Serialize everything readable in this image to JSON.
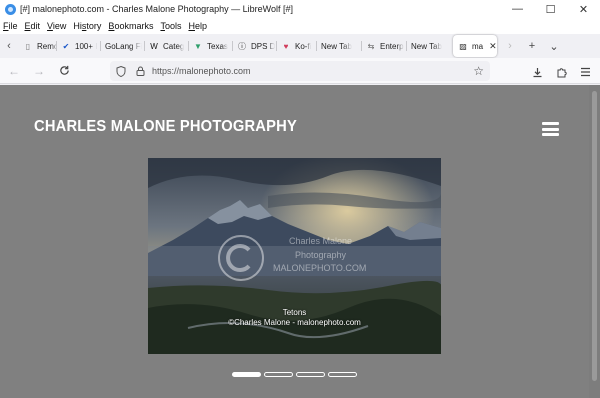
{
  "window": {
    "title": "[#] malonephoto.com - Charles Malone Photography — LibreWolf [#]",
    "controls": [
      "—",
      "☐",
      "✕"
    ]
  },
  "menu": [
    {
      "label": "File",
      "key": "F",
      "rest": "ile"
    },
    {
      "label": "Edit",
      "key": "E",
      "rest": "dit"
    },
    {
      "label": "View",
      "key": "V",
      "rest": "iew"
    },
    {
      "label": "History",
      "key": "s",
      "pre": "Hi",
      "rest": "tory"
    },
    {
      "label": "Bookmarks",
      "key": "B",
      "rest": "ookmarks"
    },
    {
      "label": "Tools",
      "key": "T",
      "rest": "ools"
    },
    {
      "label": "Help",
      "key": "H",
      "rest": "elp"
    }
  ],
  "tabs": [
    {
      "label": "Remo",
      "icon": "bookmark-icon",
      "glyph": "▯",
      "color": "#777"
    },
    {
      "label": "100+ I",
      "icon": "check-icon",
      "glyph": "✔",
      "color": "#1a57c9"
    },
    {
      "label": "GoLang Fi",
      "icon": "",
      "glyph": "",
      "color": "#555"
    },
    {
      "label": "Categ",
      "icon": "w-icon",
      "glyph": "W",
      "color": "#111"
    },
    {
      "label": "Texas",
      "icon": "vue-icon",
      "glyph": "▼",
      "color": "#2e9e6b"
    },
    {
      "label": "DPS D",
      "icon": "info-icon",
      "glyph": "ⓘ",
      "color": "#222"
    },
    {
      "label": "Ko-fi",
      "icon": "mug-icon",
      "glyph": "♥",
      "color": "#d03a5a"
    },
    {
      "label": "New Tab",
      "icon": "",
      "glyph": "",
      "color": "#555"
    },
    {
      "label": "Enterp",
      "icon": "plug-icon",
      "glyph": "⇆",
      "color": "#666"
    },
    {
      "label": "New Tab",
      "icon": "",
      "glyph": "",
      "color": "#555"
    },
    {
      "label": "ma",
      "icon": "site-icon",
      "glyph": "▨",
      "color": "#333",
      "active": true
    }
  ],
  "nav": {
    "url": "https://malonephoto.com"
  },
  "page": {
    "site_title": "CHARLES MALONE PHOTOGRAPHY",
    "slide": {
      "caption_line1": "Tetons",
      "caption_line2": "©Charles Malone - malonephoto.com",
      "watermark_line1": "Charles Malone",
      "watermark_line2": "Photography",
      "watermark_line3": "MALONEPHOTO.COM"
    },
    "slide_count": 4,
    "active_slide": 1
  },
  "colors": {
    "page_bg": "#808080",
    "title": "#ffffff",
    "browser_chrome": "#f0f0f4"
  }
}
